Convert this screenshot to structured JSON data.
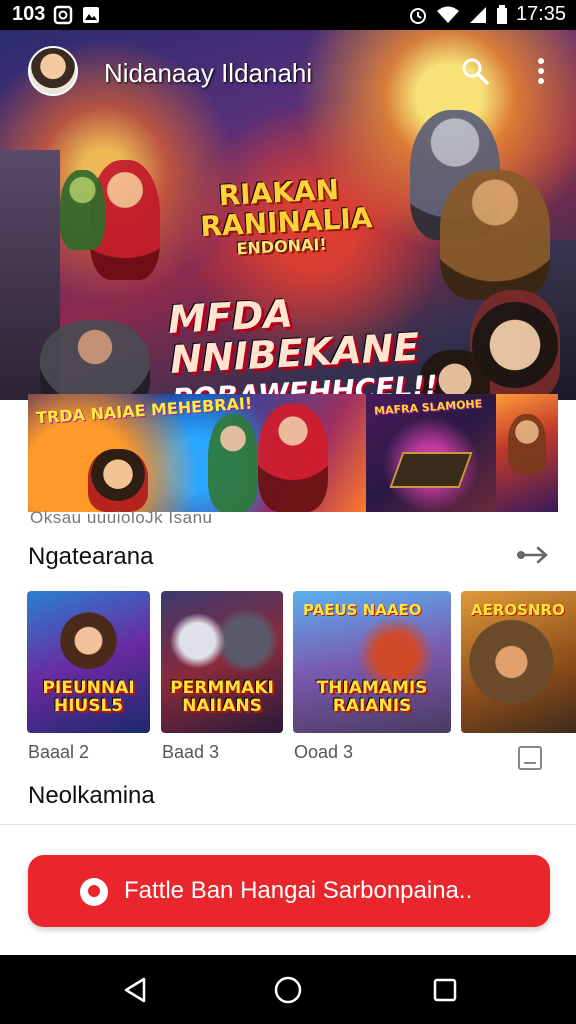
{
  "status_bar": {
    "left_text": "103",
    "icons_left": [
      "notification-box-icon",
      "image-notification-icon"
    ],
    "icons_right": [
      "alarm-icon",
      "wifi-icon",
      "signal-icon",
      "battery-icon"
    ],
    "time": "17:35"
  },
  "header": {
    "title": "Nidanaay Ildanahi",
    "icons": [
      "avatar",
      "search-icon",
      "more-vert-icon"
    ]
  },
  "hero": {
    "logo_line1": "RIAKAN",
    "logo_line2": "RANINALIA",
    "logo_line3": "ENDONAI!",
    "headline_line1": "MFDA NNIBEKANE",
    "headline_line2": "POBAWEHHCEL!!"
  },
  "featured_strip": {
    "cards": [
      {
        "label": "TRDA NAIAE MEHEBRAI!"
      },
      {
        "label": ""
      },
      {
        "label": "MAFRA SLAMOHE"
      },
      {
        "label": ""
      }
    ],
    "caption": "Oksau uuuioloJk Isanu"
  },
  "section1": {
    "title": "Ngatearana",
    "tiles": [
      {
        "art": "PIEUNNAI",
        "art2": "HIUSL5",
        "meta": "Baaal 2"
      },
      {
        "art": "PERMMAKI",
        "art2": "NAIIANS",
        "meta": "Baad 3"
      },
      {
        "art": "THIAMAMIS",
        "art2": "RAIANIS",
        "top": "PAEUS NAAEO",
        "meta": "Ooad 3"
      },
      {
        "art": "",
        "art2": "",
        "top": "AEROSNRO",
        "meta": ""
      }
    ]
  },
  "section2": {
    "title": "Neolkamina"
  },
  "cta": {
    "label": "Fattle Ban Hangai Sarbonpaina.."
  },
  "colors": {
    "accent": "#e8262b",
    "status_bar": "#000000",
    "nav_bar": "#000000"
  },
  "nav_bar": {
    "buttons": [
      "back-icon",
      "home-icon",
      "recents-icon"
    ]
  }
}
